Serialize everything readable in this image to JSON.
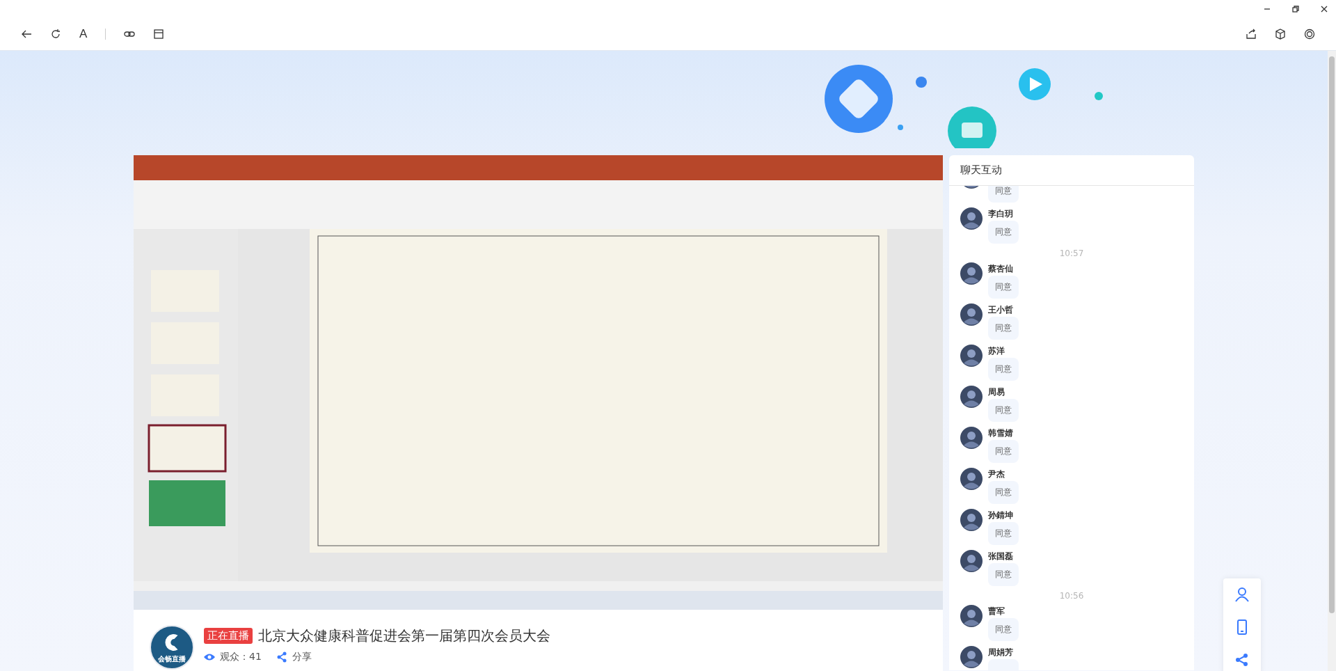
{
  "window_controls": [
    {
      "kind": "minimize"
    },
    {
      "kind": "restore"
    },
    {
      "kind": "close"
    }
  ],
  "toolbar": {
    "left": [
      {
        "kind": "back"
      },
      {
        "kind": "refresh"
      },
      {
        "kind": "text",
        "label": "A"
      },
      {
        "kind": "separator"
      },
      {
        "kind": "link"
      },
      {
        "kind": "layout"
      }
    ],
    "right": [
      {
        "kind": "share"
      },
      {
        "kind": "box"
      },
      {
        "kind": "target"
      }
    ]
  },
  "stream": {
    "logo": {
      "text": "会畅直播"
    },
    "live_badge": "正在直播",
    "title": "北京大众健康科普促进会第一届第四次会员大会",
    "viewers": "观众：41",
    "share": "分享"
  },
  "chat": {
    "title": "聊天互动",
    "messages": [
      {
        "kind": "message",
        "text": "同意"
      },
      {
        "kind": "message",
        "name": "李白玥",
        "text": "同意"
      },
      {
        "kind": "time",
        "text": "10:57"
      },
      {
        "kind": "message",
        "name": "蔡杏仙",
        "text": "同意"
      },
      {
        "kind": "message",
        "name": "王小哲",
        "text": "同意"
      },
      {
        "kind": "message",
        "name": "苏洋",
        "text": "同意"
      },
      {
        "kind": "message",
        "name": "周易",
        "text": "同意"
      },
      {
        "kind": "message",
        "name": "韩雪婧",
        "text": "同意"
      },
      {
        "kind": "message",
        "name": "尹杰",
        "text": "同意"
      },
      {
        "kind": "message",
        "name": "孙錆坤",
        "text": "同意"
      },
      {
        "kind": "message",
        "name": "张国磊",
        "text": "同意"
      },
      {
        "kind": "time",
        "text": "10:56"
      },
      {
        "kind": "message",
        "name": "曹军",
        "text": "同意"
      },
      {
        "kind": "message",
        "name": "周娟芳"
      }
    ]
  },
  "side_actions": [
    {
      "kind": "person"
    },
    {
      "kind": "phone"
    },
    {
      "kind": "share"
    }
  ]
}
